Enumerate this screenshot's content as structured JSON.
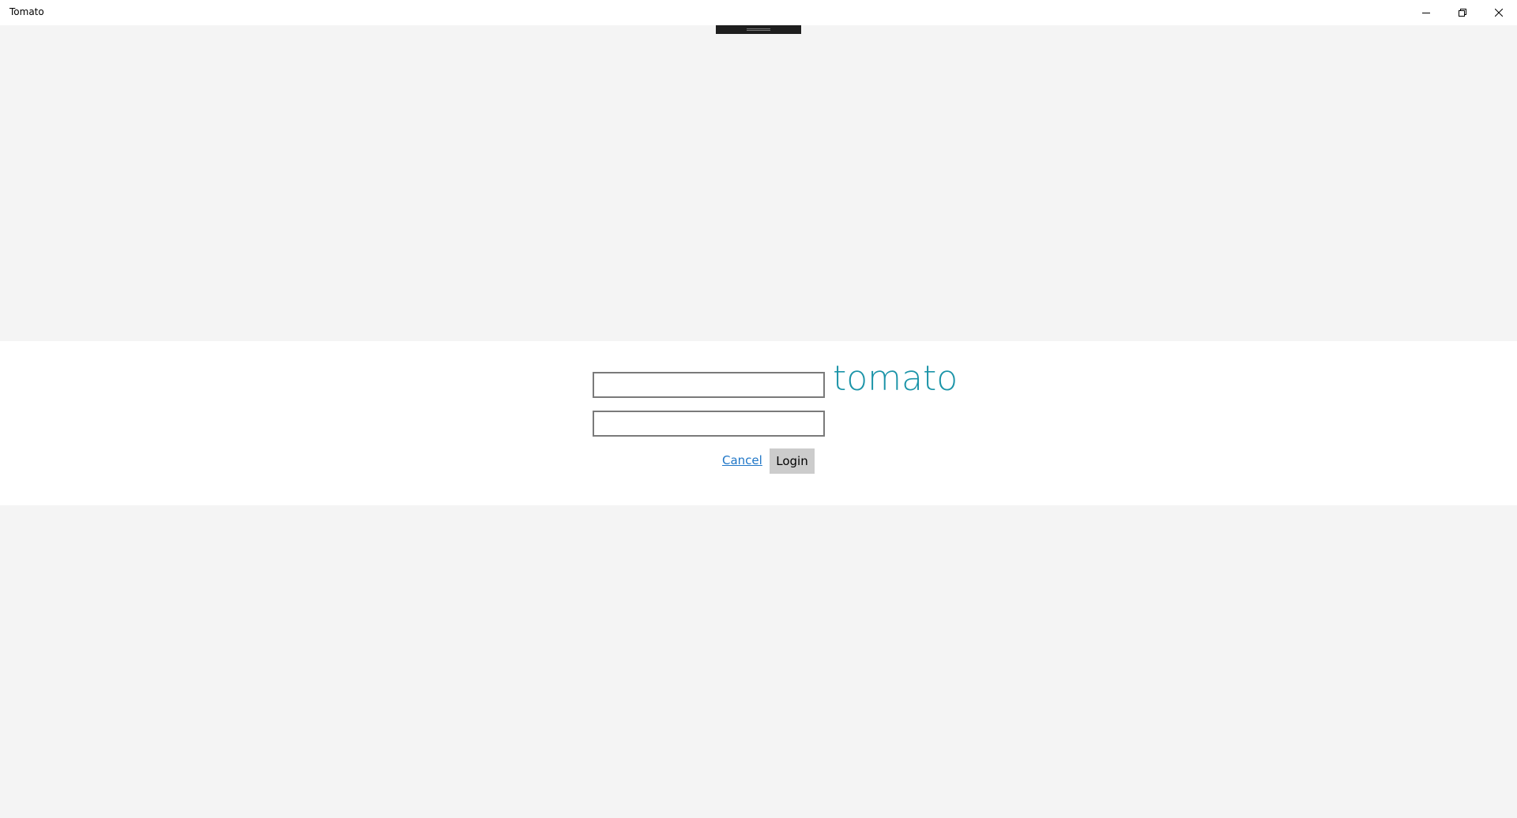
{
  "window": {
    "title": "Tomato"
  },
  "caption": {
    "minimize_icon": "minimize-icon",
    "restore_icon": "restore-icon",
    "close_icon": "close-icon"
  },
  "login": {
    "brand": "tomato",
    "username": {
      "value": "",
      "placeholder": ""
    },
    "password": {
      "value": "",
      "placeholder": ""
    },
    "cancel_label": "Cancel",
    "login_label": "Login"
  },
  "colors": {
    "brand": "#1b94a8",
    "link": "#1f76c7",
    "button_bg": "#cccccc",
    "page_bg": "#f4f4f4",
    "band_bg": "#ffffff"
  }
}
